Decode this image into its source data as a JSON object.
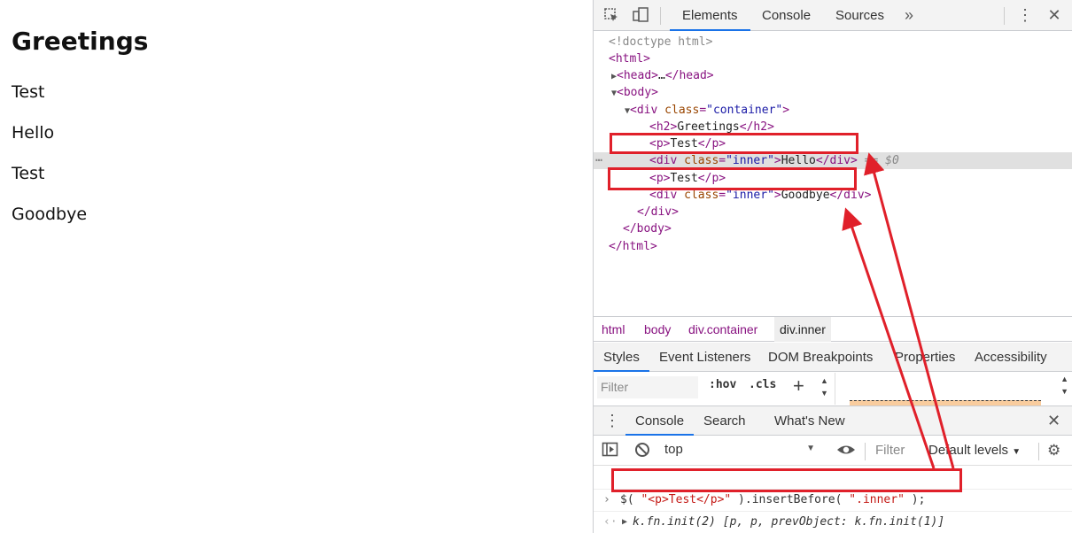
{
  "page": {
    "heading": "Greetings",
    "paragraphs": [
      "Test",
      "Hello",
      "Test",
      "Goodbye"
    ]
  },
  "devtools": {
    "tabs": [
      "Elements",
      "Console",
      "Sources"
    ],
    "more_tabs_icon": "double-chevron-icon",
    "tree": {
      "doctype": "<!doctype html>",
      "html_open": "html",
      "head_collapsed": "…",
      "body": "body",
      "container_tag": "div",
      "container_attr": "class",
      "container_val": "\"container\"",
      "h2_tag": "h2",
      "h2_text": "Greetings",
      "p_tag": "p",
      "p_text": "Test",
      "inner_tag": "div",
      "inner_attr": "class",
      "inner_val": "\"inner\"",
      "inner1_text": "Hello",
      "selected_marker": "== $0",
      "inner2_text": "Goodbye",
      "ellipsis": "…"
    },
    "breadcrumbs": [
      "html",
      "body",
      "div.container",
      "div.inner"
    ],
    "styles_tabs": [
      "Styles",
      "Event Listeners",
      "DOM Breakpoints",
      "Properties",
      "Accessibility"
    ],
    "styles_filter_placeholder": "Filter",
    "hov_label": ":hov",
    "cls_label": ".cls",
    "drawer_tabs": [
      "Console",
      "Search",
      "What's New"
    ],
    "console": {
      "context": "top",
      "filter_placeholder": "Filter",
      "levels": "Default levels",
      "input_code_prefix": "$( ",
      "input_string1": "\"<p>Test</p>\"",
      "input_code_mid": " ).insertBefore( ",
      "input_string2": "\".inner\"",
      "input_code_suffix": " );",
      "result": "k.fn.init(2) [p, p, prevObject: k.fn.init(1)]"
    },
    "annotation_color": "#e0202a",
    "accent_color": "#1a73e8"
  }
}
